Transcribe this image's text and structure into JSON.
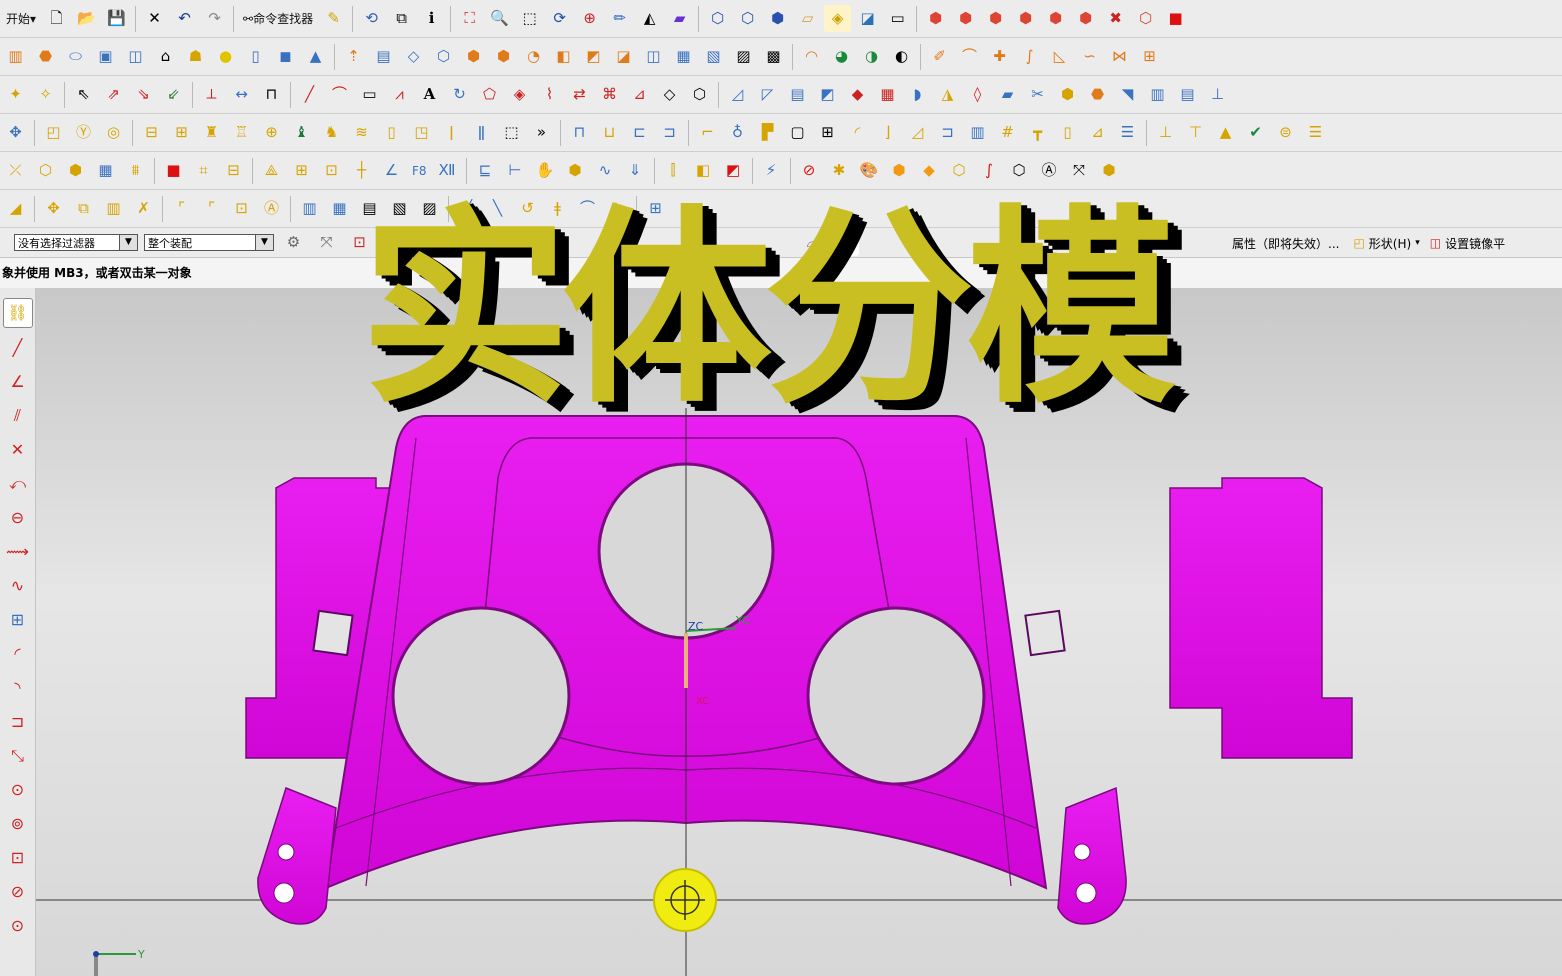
{
  "toolbar": {
    "start_label": "开始",
    "command_finder_label": "命令查找器"
  },
  "filterbar": {
    "selection_filter": "没有选择过滤器",
    "scope": "整个装配",
    "attribute_label": "属性（即将失效）...",
    "shape_label": "形状(H)",
    "mirror_label": "设置镜像平"
  },
  "status": {
    "prompt": "象并使用 MB3，或者双击某一对象"
  },
  "overlay": {
    "title": "实体分模"
  },
  "triad": {
    "zc": "ZC",
    "yc": "YC",
    "xc": "XC",
    "y": "Y"
  },
  "colors": {
    "part": "#e10ce6",
    "part_edge": "#7a0a7e",
    "title_text": "#c9bf22",
    "snap_marker": "#f0eb10"
  },
  "icons": {
    "row1": [
      "new-file-icon",
      "open-folder-icon",
      "save-icon",
      "cut-icon",
      "undo-icon",
      "redo-icon",
      "command-finder-icon",
      "brush-icon",
      "rotate-icon",
      "copy-icon",
      "info-icon",
      "fit-icon",
      "zoom-icon",
      "zoom-window-icon",
      "rotate-view-icon",
      "target-icon",
      "pencil-icon",
      "render-style-icon",
      "color-icon",
      "wireframe-icon",
      "cube-front-icon",
      "cube-iso-icon",
      "layer-icon",
      "view-cube-icon",
      "view-dropdown-icon",
      "rectangle-icon",
      "box-icon",
      "box-icon",
      "box-icon",
      "box-icon",
      "box-icon",
      "box-icon",
      "box-icon",
      "box-icon",
      "delete-icon",
      "red-box-icon"
    ]
  }
}
